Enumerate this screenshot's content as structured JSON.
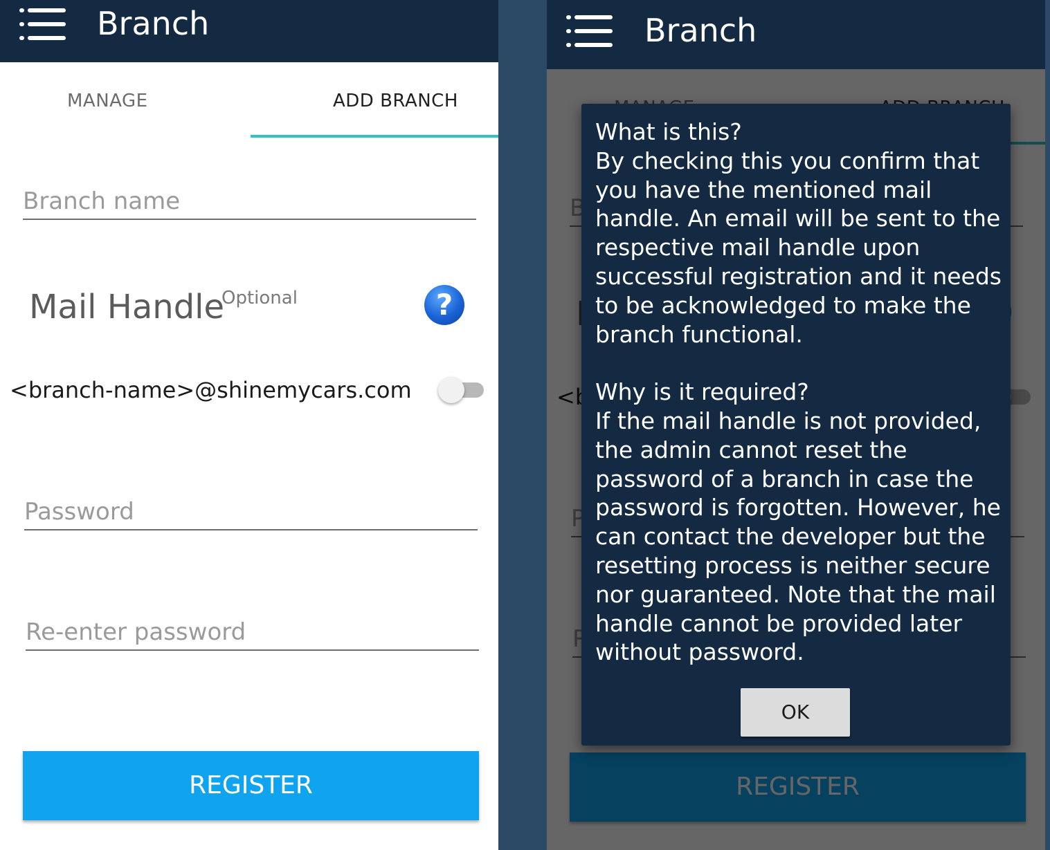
{
  "app": {
    "title": "Branch"
  },
  "tabs": [
    {
      "label": "MANAGE",
      "active": false
    },
    {
      "label": "ADD BRANCH",
      "active": true
    }
  ],
  "form": {
    "branch_name_placeholder": "Branch name",
    "mail_handle_title": "Mail Handle",
    "mail_handle_optional": "Optional",
    "mail_handle_value": "<branch-name>@shinemycars.com",
    "mail_handle_enabled": false,
    "password_placeholder": "Password",
    "reenter_password_placeholder": "Re-enter password",
    "register_label": "REGISTER"
  },
  "dialog": {
    "text": "What is this?\n By checking this you confirm that you have the mentioned mail handle. An email will be sent to the respective mail handle upon successful registration and it needs to be acknowledged to make the branch functional.\n\nWhy is it required?\n If the mail handle is not provided, the admin cannot reset the password of a branch in case the password is forgotten. However, he can contact the developer but the resetting process is neither secure nor guaranteed. Note that the mail handle cannot be provided later without password.",
    "ok_label": "OK"
  },
  "icons": {
    "menu": "hamburger-menu-icon",
    "help": "question-mark-icon"
  },
  "colors": {
    "app_bar": "#132a42",
    "tab_indicator": "#2ec4c4",
    "register_button": "#10a3f0",
    "help_icon": "#1a63d6",
    "background_gap": "#2c4a66"
  }
}
